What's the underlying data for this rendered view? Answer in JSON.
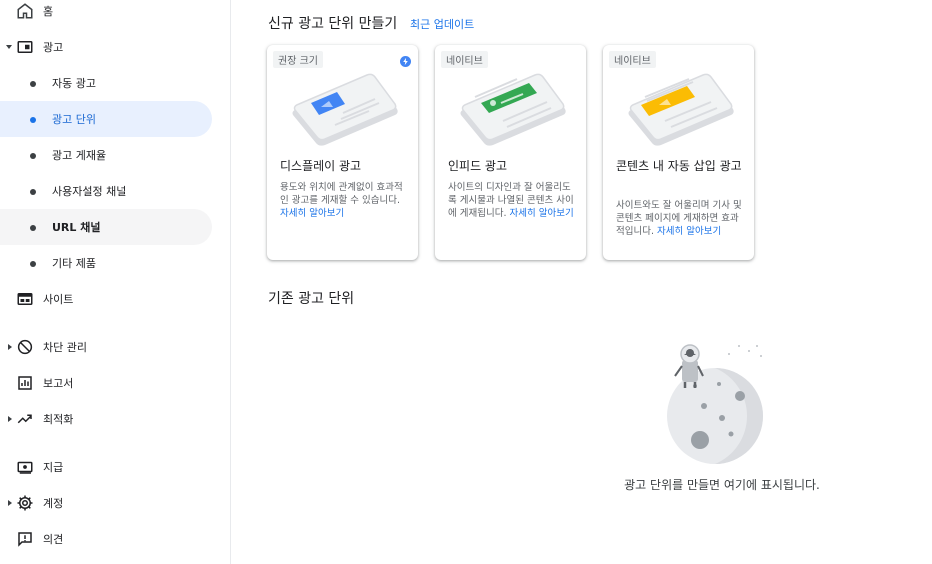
{
  "sidebar": {
    "items": [
      {
        "label": "홈",
        "icon": "home-icon"
      },
      {
        "label": "광고",
        "icon": "ads-icon",
        "expanded": true
      },
      {
        "label": "자동 광고"
      },
      {
        "label": "광고 단위",
        "selected": true
      },
      {
        "label": "광고 게재율"
      },
      {
        "label": "사용자설정 채널"
      },
      {
        "label": "URL 채널"
      },
      {
        "label": "기타 제품"
      },
      {
        "label": "사이트",
        "icon": "sites-icon"
      },
      {
        "label": "차단 관리",
        "icon": "block-icon"
      },
      {
        "label": "보고서",
        "icon": "reports-icon"
      },
      {
        "label": "최적화",
        "icon": "optimization-icon"
      },
      {
        "label": "지급",
        "icon": "payments-icon"
      },
      {
        "label": "계정",
        "icon": "gear-icon"
      },
      {
        "label": "의견",
        "icon": "feedback-icon"
      }
    ]
  },
  "main": {
    "new_section_title": "신규 광고 단위 만들기",
    "updates_link": "최근 업데이트",
    "cards": [
      {
        "chip": "권장 크기",
        "title": "디스플레이 광고",
        "desc": "용도와 위치에 관계없이 효과적인 광고를 게재할 수 있습니다. ",
        "more": "자세히 알아보기"
      },
      {
        "chip": "네이티브",
        "title": "인피드 광고",
        "desc": "사이트의 디자인과 잘 어울리도록 게시물과 나열된 콘텐츠 사이에 게재됩니다. ",
        "more": "자세히 알아보기"
      },
      {
        "chip": "네이티브",
        "title": "콘텐츠 내 자동 삽입 광고",
        "desc": "사이트와도 잘 어울리며 기사 및 콘텐츠 페이지에 게재하면 효과적입니다. ",
        "more": "자세히 알아보기"
      }
    ],
    "existing_section_title": "기존 광고 단위",
    "empty_state": "광고 단위를 만들면 여기에 표시됩니다."
  },
  "colors": {
    "accent": "#1a73e8",
    "selected_bg": "#e8f0fe",
    "display_blue": "#4285f4",
    "infeed_green": "#34a853",
    "incontent_yellow": "#fbbc04"
  }
}
